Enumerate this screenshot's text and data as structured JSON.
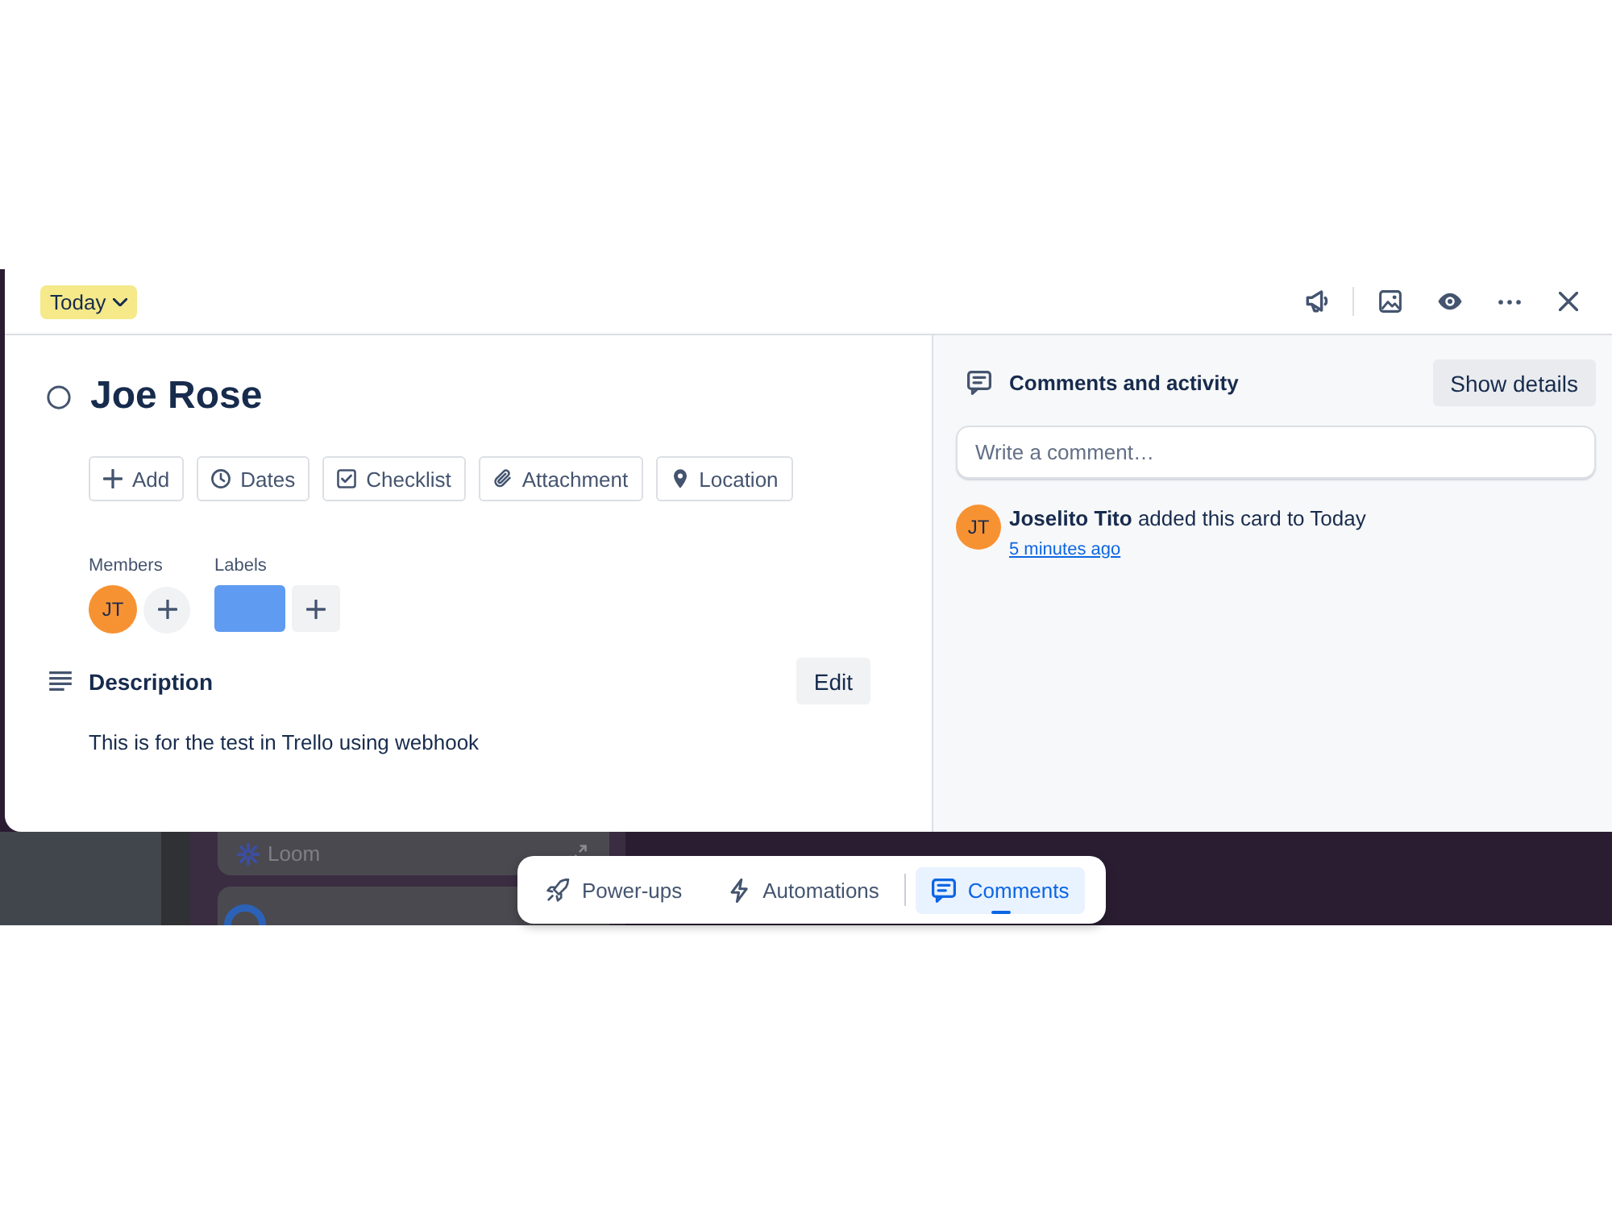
{
  "card_header": {
    "list_name": "Today"
  },
  "card": {
    "complete": false,
    "title": "Joe Rose",
    "actions": [
      {
        "kind": "add",
        "label": "Add"
      },
      {
        "kind": "dates",
        "label": "Dates"
      },
      {
        "kind": "checklist",
        "label": "Checklist"
      },
      {
        "kind": "attachment",
        "label": "Attachment"
      },
      {
        "kind": "location",
        "label": "Location"
      }
    ],
    "members": {
      "heading": "Members",
      "people": [
        {
          "initials": "JT"
        }
      ]
    },
    "labels": {
      "heading": "Labels",
      "items": [
        {
          "color": "#5f9bf0"
        }
      ]
    },
    "description": {
      "heading": "Description",
      "edit": "Edit",
      "text": "This is for the test in Trello using webhook"
    }
  },
  "activity": {
    "heading": "Comments and activity",
    "show_details": "Show details",
    "comment_box": {
      "placeholder": "Write a comment…"
    },
    "entries": [
      {
        "initials": "JT",
        "text": "**Joselito Tito** added this card to Today",
        "time": "5 minutes ago"
      }
    ]
  },
  "background_board": {
    "cards": [
      {
        "title": "Loom"
      }
    ]
  },
  "bottom_bar": {
    "items": [
      {
        "kind": "power-ups",
        "label": "Power-ups",
        "selected": false
      },
      {
        "kind": "automations",
        "label": "Automations",
        "selected": false
      },
      {
        "kind": "comments",
        "label": "Comments",
        "selected": true
      }
    ]
  }
}
